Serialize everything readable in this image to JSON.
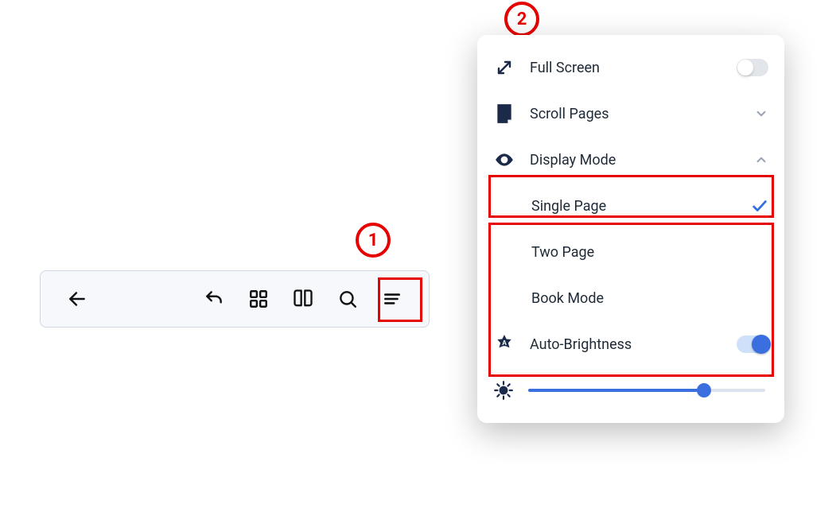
{
  "callouts": {
    "one": "1",
    "two": "2"
  },
  "toolbar": {
    "back": "back",
    "undo": "undo",
    "grid": "grid",
    "book": "book-open",
    "search": "search",
    "menu": "menu"
  },
  "panel": {
    "fullscreen": {
      "label": "Full Screen",
      "on": false
    },
    "scrollpages": {
      "label": "Scroll Pages"
    },
    "displaymode": {
      "label": "Display Mode"
    },
    "options": {
      "single": {
        "label": "Single Page",
        "selected": true
      },
      "two": {
        "label": "Two Page",
        "selected": false
      },
      "book": {
        "label": "Book Mode",
        "selected": false
      }
    },
    "autobright": {
      "label": "Auto-Brightness",
      "on": true
    },
    "brightness": {
      "value": 75
    }
  }
}
